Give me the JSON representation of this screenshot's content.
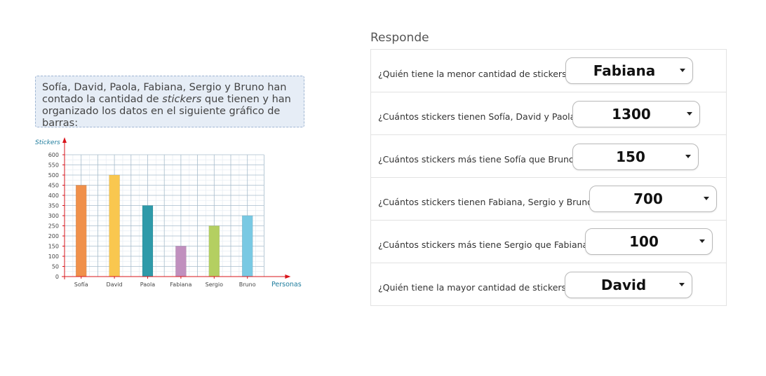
{
  "prompt": {
    "line1": "Sofía, David, Paola, Fabiana, Sergio y Bruno han",
    "line2_a": "contado la cantidad de ",
    "line2_b": "stickers",
    "line2_c": " que tienen y han",
    "line3": "organizado los datos en el siguiente gráfico de barras:"
  },
  "chart_data": {
    "type": "bar",
    "categories": [
      "Sofía",
      "David",
      "Paola",
      "Fabiana",
      "Sergio",
      "Bruno"
    ],
    "values": [
      450,
      500,
      350,
      150,
      250,
      300
    ],
    "colors": [
      "#f0904a",
      "#f9c74f",
      "#2f9aa9",
      "#c08fbe",
      "#b4cf61",
      "#79c9e3"
    ],
    "ylabel": "Stickers",
    "xlabel": "Personas",
    "ylim": [
      0,
      600
    ],
    "yticks": [
      0,
      50,
      100,
      150,
      200,
      250,
      300,
      350,
      400,
      450,
      500,
      550,
      600
    ],
    "grid": true,
    "axis_color": "#d9141b",
    "label_color": "#1c7b9c"
  },
  "responde": {
    "title": "Responde",
    "questions": [
      {
        "text": "¿Quién tiene la menor cantidad de stickers?",
        "answer": "Fabiana"
      },
      {
        "text": "¿Cuántos stickers tienen Sofía, David y Paola?",
        "answer": "1300"
      },
      {
        "text": "¿Cuántos stickers más tiene Sofía que Bruno?",
        "answer": "150"
      },
      {
        "text": "¿Cuántos stickers tienen Fabiana, Sergio y Bruno?",
        "answer": "700"
      },
      {
        "text": "¿Cuántos stickers más tiene Sergio que Fabiana?",
        "answer": "100"
      },
      {
        "text": "¿Quién tiene la mayor cantidad de stickers?",
        "answer": "David"
      }
    ]
  }
}
